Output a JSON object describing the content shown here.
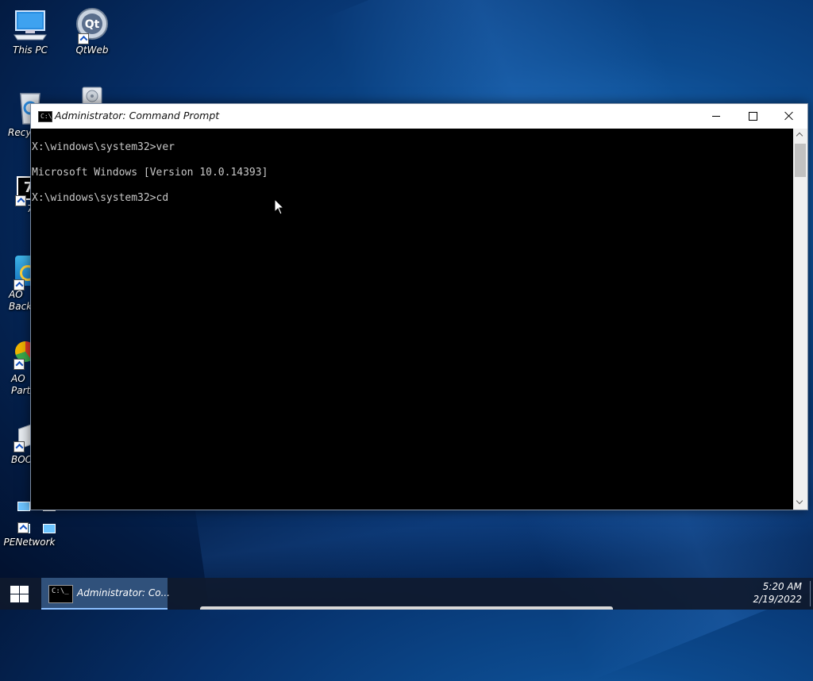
{
  "desktop": {
    "icons": [
      {
        "label": "This PC",
        "icon": "monitor-icon"
      },
      {
        "label": "QtWeb",
        "icon": "qtweb-icon"
      },
      {
        "label": "Recyc",
        "icon": "recycle-bin-icon"
      },
      {
        "label": "",
        "icon": "disc-drive-icon"
      },
      {
        "label": "7",
        "icon": "7zip-icon"
      },
      {
        "label": "AO\nBack",
        "icon": "aomei-backupper-icon"
      },
      {
        "label": "AO\nParti",
        "icon": "aomei-partition-icon"
      },
      {
        "label": "BOO",
        "icon": "bootice-icon"
      },
      {
        "label": "PENetwork",
        "icon": "network-icon"
      }
    ]
  },
  "window": {
    "title": "Administrator: Command Prompt",
    "icon": "cmd-icon",
    "icon_glyph": "C:\\",
    "console_lines": [
      "X:\\windows\\system32>ver",
      "",
      "Microsoft Windows [Version 10.0.14393]",
      "",
      "X:\\windows\\system32>cd"
    ],
    "scrollbar": {
      "position": 0
    }
  },
  "taskbar": {
    "start_icon": "windows-logo-icon",
    "app_label": "Administrator: Co...",
    "app_icon_glyph": "C:\\_",
    "time": "5:20 AM",
    "date": "2/19/2022"
  }
}
